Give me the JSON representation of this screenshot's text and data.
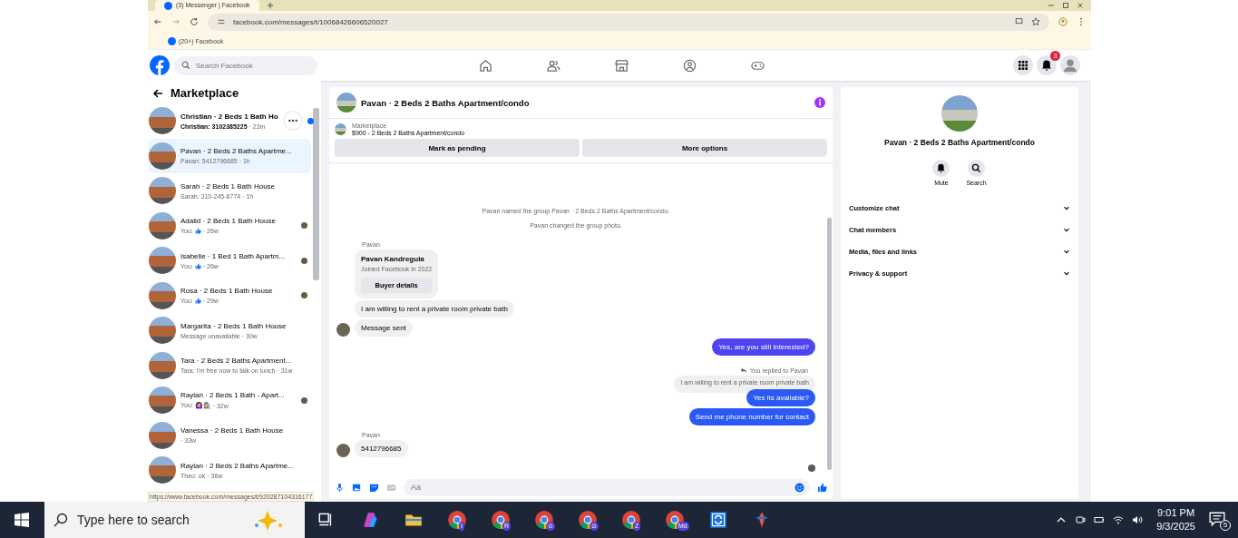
{
  "browser": {
    "tab_title": "(3) Messenger | Facebook",
    "url": "facebook.com/messages/t/10068426606520027",
    "bookmarks": [
      {
        "label": "(20+) Facebook"
      }
    ]
  },
  "header": {
    "search": {
      "placeholder": "Search Facebook"
    },
    "nav": [
      {
        "kind": "home",
        "selected": false
      },
      {
        "kind": "friends",
        "selected": false
      },
      {
        "kind": "store",
        "selected": false
      },
      {
        "kind": "groups",
        "selected": false
      },
      {
        "kind": "gaming",
        "selected": false
      }
    ],
    "notification_count": "3"
  },
  "sidebar": {
    "title": "Marketplace",
    "status_url": "https://www.facebook.com/messages/t/920287104316177",
    "items": [
      {
        "title": "Christian · 2 Beds 1 Bath Ho",
        "preview": "Christian: 3102385225",
        "time": "· 23m",
        "unread": true,
        "selected": false,
        "like": false,
        "seen": false,
        "menu": true
      },
      {
        "title": "Pavan · 2 Beds 2 Baths Apartme...",
        "preview": "Pavan: 5412796685",
        "time": "· 1h",
        "unread": false,
        "selected": true,
        "like": false,
        "seen": false,
        "menu": false
      },
      {
        "title": "Sarah · 2 Beds 1 Bath House",
        "preview": "Sarah: 310-245-8774",
        "time": "· 1h",
        "unread": false,
        "selected": false,
        "like": false,
        "seen": false,
        "menu": false
      },
      {
        "title": "Adalid · 2 Beds 1 Bath House",
        "preview": "You:",
        "time": "· 26w",
        "unread": false,
        "selected": false,
        "like": true,
        "seen": true,
        "menu": false
      },
      {
        "title": "Isabelle · 1 Bed 1 Bath Apartm...",
        "preview": "You:",
        "time": "· 26w",
        "unread": false,
        "selected": false,
        "like": true,
        "seen": true,
        "menu": false
      },
      {
        "title": "Rosa · 2 Beds 1 Bath House",
        "preview": "You:",
        "time": "· 29w",
        "unread": false,
        "selected": false,
        "like": true,
        "seen": true,
        "menu": false
      },
      {
        "title": "Margarita · 2 Beds 1 Bath House",
        "preview": "Message unavailable",
        "time": "· 30w",
        "unread": false,
        "selected": false,
        "like": false,
        "seen": false,
        "menu": false
      },
      {
        "title": "Tara · 2 Beds 2 Baths Apartment...",
        "preview": "Tara: I'm free now to talk on lunch",
        "time": "· 31w",
        "unread": false,
        "selected": false,
        "like": false,
        "seen": false,
        "menu": false
      },
      {
        "title": "Raylan · 2 Beds 1 Bath - Apart...",
        "preview": "You: 🙆‍♀️🧑‍🔧",
        "time": "· 32w",
        "unread": false,
        "selected": false,
        "like": false,
        "seen": true,
        "menu": false
      },
      {
        "title": "Vanessa · 2 Beds 1 Bath House",
        "time": "· 33w",
        "unread": false,
        "selected": false,
        "like": false,
        "seen": false,
        "menu": false
      },
      {
        "title": "Raylan · 2 Beds 2 Baths Apartme...",
        "preview": "Theo: ok",
        "time": "· 36w",
        "unread": false,
        "selected": false,
        "like": false,
        "seen": false,
        "menu": false
      }
    ]
  },
  "chat": {
    "title": "Pavan · 2 Beds 2 Baths Apartment/condo",
    "listing_label": "Marketplace",
    "listing": "$900 - 2 Beds 2 Baths Apartment/condo",
    "actions": [
      "Mark as pending",
      "More options"
    ],
    "messages": [
      {
        "kind": "system",
        "text": "Pavan named the group Pavan · 2 Beds 2 Baths Apartment/condo."
      },
      {
        "kind": "system",
        "text": "Pavan changed the group photo."
      },
      {
        "kind": "sender",
        "text": "Pavan"
      },
      {
        "kind": "card",
        "title": "Pavan Kandregula",
        "subtitle": "Joined Facebook in 2022",
        "button": "Buyer details"
      },
      {
        "kind": "incoming",
        "text": "I am willing to rent a private room private bath",
        "avatar": false
      },
      {
        "kind": "incoming",
        "text": "Message sent",
        "avatar": true
      },
      {
        "kind": "outgoing",
        "text": "Yes, are you still interested?",
        "color": "#4f45f0"
      },
      {
        "kind": "reply_note",
        "text": "You replied to Pavan"
      },
      {
        "kind": "quoted",
        "text": "I am willing to rent a private room private bath"
      },
      {
        "kind": "outgoing",
        "text": "Yes its available?",
        "color": "#2b59f5"
      },
      {
        "kind": "outgoing",
        "text": "Send me phone number for contact",
        "color": "#2b59f5"
      },
      {
        "kind": "sender",
        "text": "Pavan"
      },
      {
        "kind": "incoming",
        "text": "5412796685",
        "avatar": true
      }
    ],
    "composer": {
      "placeholder": "Aa"
    }
  },
  "details": {
    "title": "Pavan · 2 Beds 2 Baths Apartment/condo",
    "actions": [
      {
        "kind": "bell",
        "label": "Mute"
      },
      {
        "kind": "search",
        "label": "Search"
      }
    ],
    "sections": [
      {
        "label": "Customize chat",
        "expanded": false
      },
      {
        "label": "Chat members",
        "expanded": false
      },
      {
        "label": "Media, files and links",
        "expanded": false
      },
      {
        "label": "Privacy & support",
        "expanded": false
      }
    ]
  },
  "taskbar": {
    "search": {
      "placeholder": "Type here to search"
    },
    "apps": [
      {
        "kind": "task-view"
      },
      {
        "kind": "copilot"
      },
      {
        "kind": "folder"
      },
      {
        "kind": "chrome",
        "badge": "I"
      },
      {
        "kind": "chrome",
        "badge": "R"
      },
      {
        "kind": "chrome",
        "badge": "⊙"
      },
      {
        "kind": "chrome",
        "badge": "⊙"
      },
      {
        "kind": "chrome",
        "badge": "Z"
      },
      {
        "kind": "chrome",
        "badge": "Md"
      },
      {
        "kind": "sync"
      },
      {
        "kind": "tool"
      }
    ],
    "time": "9:01 PM",
    "date": "9/3/2025",
    "notifications": "5"
  }
}
